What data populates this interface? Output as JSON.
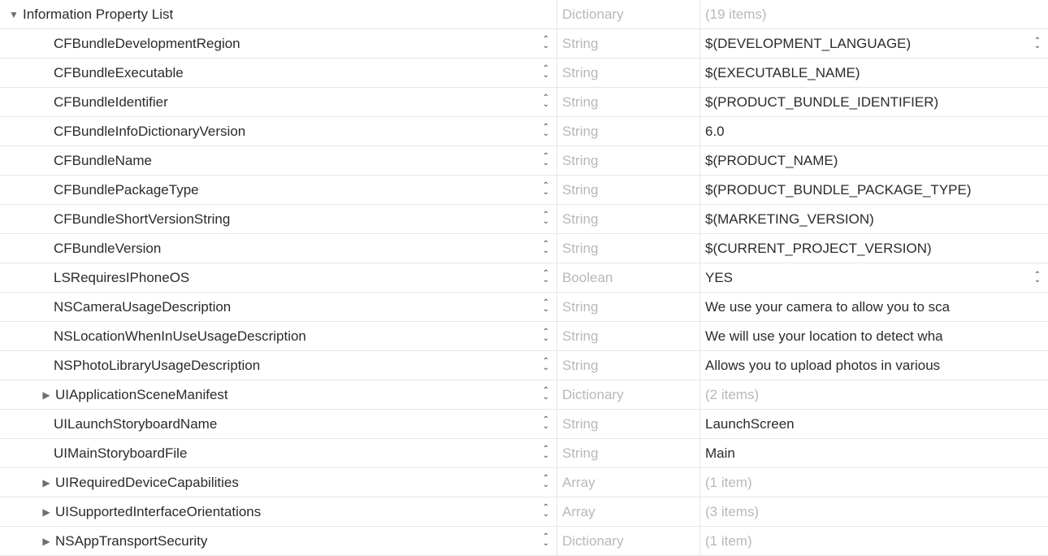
{
  "root": {
    "key": "Information Property List",
    "type": "Dictionary",
    "summary": "(19 items)"
  },
  "rows": [
    {
      "key": "CFBundleDevelopmentRegion",
      "type": "String",
      "value": "$(DEVELOPMENT_LANGUAGE)",
      "valueStepper": true
    },
    {
      "key": "CFBundleExecutable",
      "type": "String",
      "value": "$(EXECUTABLE_NAME)"
    },
    {
      "key": "CFBundleIdentifier",
      "type": "String",
      "value": "$(PRODUCT_BUNDLE_IDENTIFIER)"
    },
    {
      "key": "CFBundleInfoDictionaryVersion",
      "type": "String",
      "value": "6.0"
    },
    {
      "key": "CFBundleName",
      "type": "String",
      "value": "$(PRODUCT_NAME)"
    },
    {
      "key": "CFBundlePackageType",
      "type": "String",
      "value": "$(PRODUCT_BUNDLE_PACKAGE_TYPE)"
    },
    {
      "key": "CFBundleShortVersionString",
      "type": "String",
      "value": "$(MARKETING_VERSION)"
    },
    {
      "key": "CFBundleVersion",
      "type": "String",
      "value": "$(CURRENT_PROJECT_VERSION)"
    },
    {
      "key": "LSRequiresIPhoneOS",
      "type": "Boolean",
      "value": "YES",
      "valueStepper": true
    },
    {
      "key": "NSCameraUsageDescription",
      "type": "String",
      "value": "We use your camera to allow you to sca"
    },
    {
      "key": "NSLocationWhenInUseUsageDescription",
      "type": "String",
      "value": "We will use your location to detect wha"
    },
    {
      "key": "NSPhotoLibraryUsageDescription",
      "type": "String",
      "value": "Allows you to upload photos in various"
    },
    {
      "key": "UIApplicationSceneManifest",
      "type": "Dictionary",
      "summary": "(2 items)",
      "disclosure": "right"
    },
    {
      "key": "UILaunchStoryboardName",
      "type": "String",
      "value": "LaunchScreen"
    },
    {
      "key": "UIMainStoryboardFile",
      "type": "String",
      "value": "Main"
    },
    {
      "key": "UIRequiredDeviceCapabilities",
      "type": "Array",
      "summary": "(1 item)",
      "disclosure": "right"
    },
    {
      "key": "UISupportedInterfaceOrientations",
      "type": "Array",
      "summary": "(3 items)",
      "disclosure": "right"
    },
    {
      "key": "NSAppTransportSecurity",
      "type": "Dictionary",
      "summary": "(1 item)",
      "disclosure": "right"
    }
  ]
}
